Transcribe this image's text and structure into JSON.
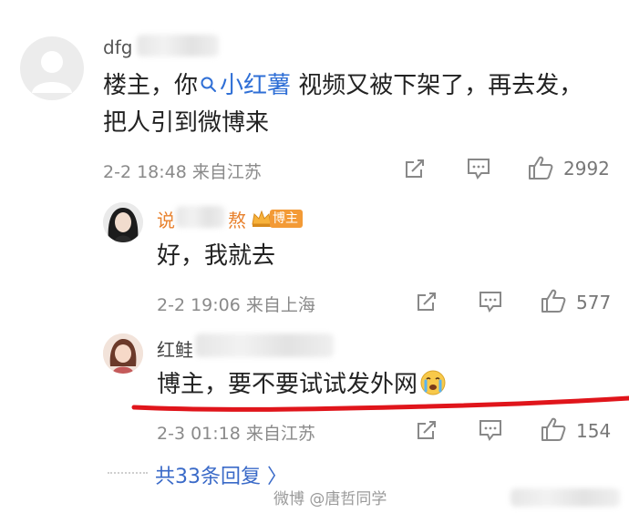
{
  "comment1": {
    "username_visible": "dfg",
    "text_line1_before": "楼主，你",
    "topic": "小红薯",
    "text_line1_after": " 视频又被下架了，再去发，",
    "text_line2": "把人引到微博来",
    "time": "2-2 18:48",
    "location": "来自江苏",
    "like_count": "2992"
  },
  "reply1": {
    "username_prefix": "说",
    "username_suffix": "熬",
    "badge_label": "博主",
    "text": "好，我就去",
    "time": "2-2 19:06",
    "location": "来自上海",
    "like_count": "577"
  },
  "reply2": {
    "username_prefix": "红鲑",
    "text": "博主，要不要试试发外网",
    "time": "2-3 01:18",
    "location": "来自江苏",
    "like_count": "154"
  },
  "more_replies": "共33条回复 〉",
  "watermark": "微博 @唐哲同学",
  "icons": {
    "share": "share-icon",
    "comment": "comment-icon",
    "like": "thumbs-up-icon",
    "crown": "crown-icon",
    "crying_emoji": "crying-emoji-icon",
    "search": "search-icon"
  },
  "colors": {
    "link": "#2f6fd6",
    "author_name": "#e8812d",
    "badge": "#f39a36",
    "annotation_line": "#e0151b",
    "more_replies": "#3a6ac8"
  }
}
